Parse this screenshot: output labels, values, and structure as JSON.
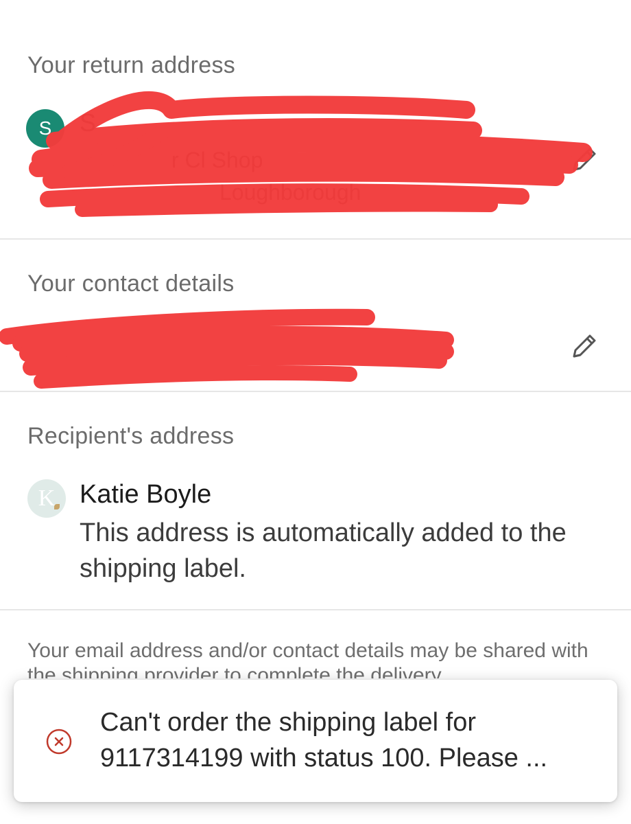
{
  "return_address": {
    "title": "Your return address",
    "avatar_initial": "S",
    "avatar_color": "#1a8a73",
    "sender_name_visible": "S",
    "line1_visible": "r Cl   Shop",
    "line2_visible": "Loughborough",
    "edit_icon": "pencil-icon"
  },
  "contact_details": {
    "title": "Your contact details",
    "line_visible": "",
    "edit_icon": "pencil-icon"
  },
  "recipient": {
    "title": "Recipient's address",
    "avatar_initial": "K",
    "name": "Katie Boyle",
    "note": "This address is automatically added to the shipping label."
  },
  "footnote": {
    "text": "Your email address and/or contact details may be shared with the shipping provider to complete the delivery"
  },
  "toast": {
    "icon": "error-circle-x-icon",
    "accent_color": "#c0392b",
    "message": "Can't order the shipping label for 9117314199 with status 100. Please ..."
  },
  "redaction_color": "#f23c3c"
}
